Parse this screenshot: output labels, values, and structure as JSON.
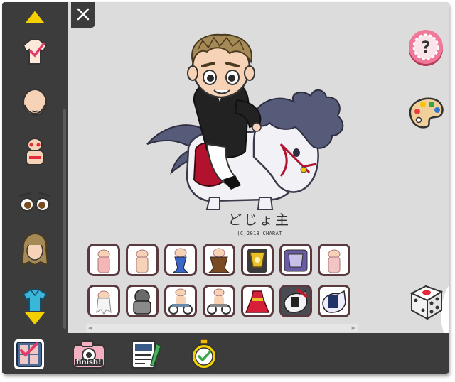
{
  "character": {
    "name": "どじょ主",
    "copyright": "(C)2018 CHARAT"
  },
  "sidebar": {
    "items": [
      {
        "icon": "chevron-up-icon"
      },
      {
        "icon": "shirt-check-icon"
      },
      {
        "icon": "face-base-icon"
      },
      {
        "icon": "body-icon"
      },
      {
        "icon": "eyes-icon"
      },
      {
        "icon": "hair-icon"
      },
      {
        "icon": "clothes-icon"
      },
      {
        "icon": "chevron-down-icon"
      }
    ]
  },
  "toolbar": {
    "tools": [
      {
        "icon": "parts-panel-icon"
      },
      {
        "icon": "camera-finish-icon",
        "label": "finish!"
      },
      {
        "icon": "memo-icon"
      },
      {
        "icon": "stopwatch-icon"
      }
    ]
  },
  "parts": {
    "row1": [
      "body-pink",
      "body-plain",
      "mermaid-blue",
      "mermaid-brown",
      "gold-armor",
      "purple-armor",
      "body-blush"
    ],
    "row2": [
      "ghost-white",
      "gray-beast",
      "wheelchair-1",
      "wheelchair-2",
      "red-dress",
      "black-horse",
      "navy-horse"
    ]
  },
  "colors": {
    "stage_bg": "#dcdcdc",
    "frame_bg": "#3c3c3c",
    "accent_yellow": "#f5d000",
    "help_pink": "#e55a7a",
    "part_border": "#5a3a3e"
  }
}
